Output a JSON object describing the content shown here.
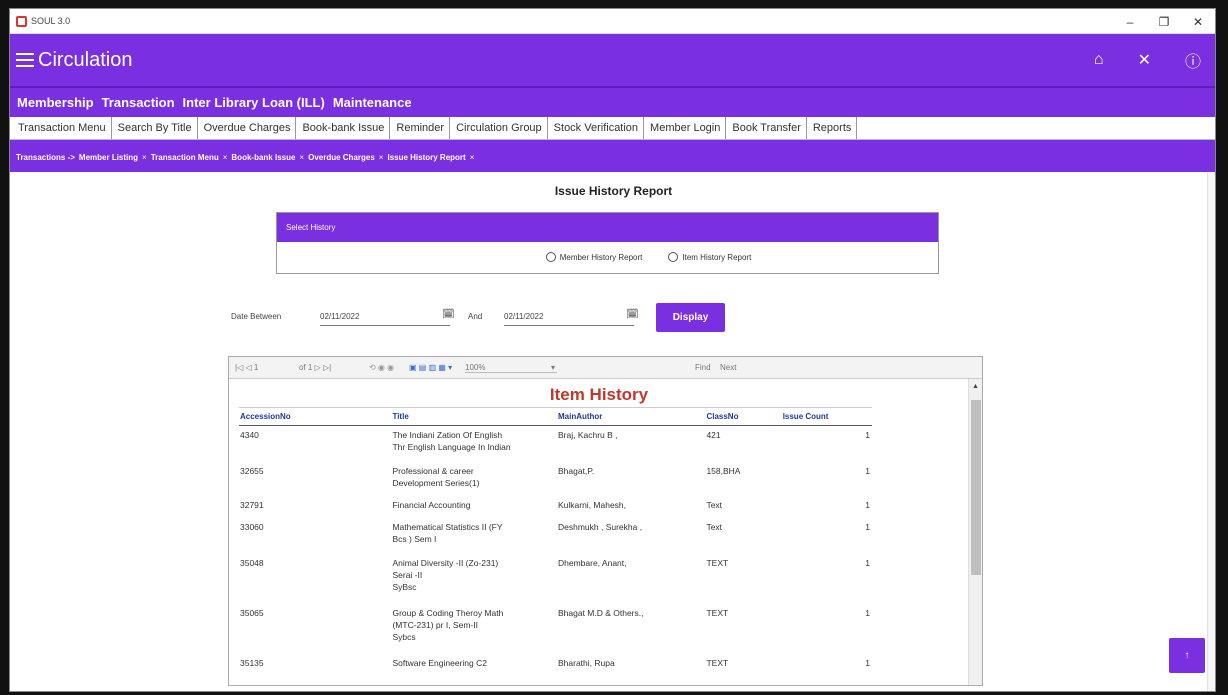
{
  "window": {
    "title": "SOUL 3.0",
    "controls": [
      "–",
      "❐",
      "✕"
    ]
  },
  "header": {
    "title": "Circulation",
    "icons": [
      "home-icon",
      "close-icon",
      "help-icon"
    ]
  },
  "menu": [
    "Membership",
    "Transaction",
    "Inter Library Loan (ILL)",
    "Maintenance"
  ],
  "tabs": [
    "Transaction Menu",
    "Search By Title",
    "Overdue Charges",
    "Book-bank Issue",
    "Reminder",
    "Circulation Group",
    "Stock Verification",
    "Member Login",
    "Book Transfer",
    "Reports"
  ],
  "breadcrumbs": [
    "Transactions ->",
    "Member Listing",
    "Transaction Menu",
    "Book-bank Issue",
    "Overdue Charges",
    "Issue History Report"
  ],
  "page": {
    "title": "Issue History Report",
    "select_history_label": "Select History",
    "radio_member": "Member History Report",
    "radio_item": "Item History Report",
    "date_between_label": "Date Between",
    "from_date": "02/11/2022",
    "and_label": "And",
    "to_date": "02/11/2022",
    "display_button": "Display"
  },
  "viewer_toolbar": {
    "page_nav": "|◁ ◁ 1",
    "page_of": "of 1 ▷ ▷|",
    "zoom": "100%",
    "find": "Find",
    "next": "Next"
  },
  "report": {
    "title": "Item History",
    "columns": [
      "AccessionNo",
      "Title",
      "MainAuthor",
      "ClassNo",
      "Issue Count"
    ],
    "rows": [
      {
        "acc": "4340",
        "title1": "The Indiani Zation Of English",
        "title2": "Thr English Language In Indian",
        "title3": "",
        "author": "Braj, Kachru B ,",
        "class": "421",
        "count": "1"
      },
      {
        "acc": "32655",
        "title1": "Professional & career",
        "title2": "Development Series(1)",
        "title3": "",
        "author": "Bhagat,P.",
        "class": "158,BHA",
        "count": "1"
      },
      {
        "acc": "32791",
        "title1": "Financial Accounting",
        "title2": "",
        "title3": "",
        "author": "Kulkarni, Mahesh,",
        "class": "Text",
        "count": "1"
      },
      {
        "acc": "33060",
        "title1": "Mathematical Statistics II (FY",
        "title2": "Bcs ) Sem I",
        "title3": "",
        "author": "Deshmukh , Surekha ,",
        "class": "Text",
        "count": "1"
      },
      {
        "acc": "35048",
        "title1": "Animal Diversity -II (Zo-231)",
        "title2": "Serai -II",
        "title3": "SyBsc",
        "author": "Dhembare, Anant,",
        "class": "TEXT",
        "count": "1"
      },
      {
        "acc": "35065",
        "title1": "Group & Coding Theroy Math",
        "title2": "(MTC-231) pr I, Sem-II",
        "title3": "Sybcs",
        "author": "Bhagat M.D & Others.,",
        "class": "TEXT",
        "count": "1"
      },
      {
        "acc": "35135",
        "title1": "Software Engineering C2",
        "title2": "",
        "title3": "",
        "author": "Bharathi, Rupa",
        "class": "TEXT",
        "count": "1"
      }
    ]
  },
  "scroll_top_label": "↑",
  "colors": {
    "primary": "#7a2fe0",
    "report_title": "#c0392b",
    "column_header": "#1f3a93"
  }
}
